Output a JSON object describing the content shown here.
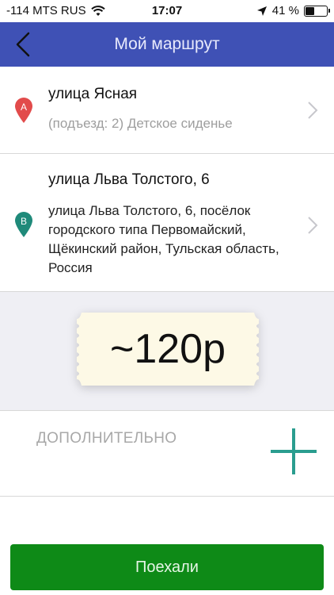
{
  "status_bar": {
    "carrier": "-114 MTS RUS",
    "time": "17:07",
    "battery_text": "41 %",
    "battery_level": 0.41
  },
  "nav": {
    "title": "Мой маршрут"
  },
  "route": {
    "point_a": {
      "marker": "A",
      "marker_color": "#e24b4b",
      "title": "улица Ясная",
      "subtitle": "(подъезд: 2) Детское сиденье"
    },
    "point_b": {
      "marker": "B",
      "marker_color": "#1f8a7a",
      "title": "улица Льва Толстого, 6",
      "address": "улица Льва Толстого, 6, посёлок городского типа Первомайский, Щёкинский район, Тульская область, Россия"
    }
  },
  "price": {
    "value": "~120р",
    "ticket_color": "#fdf9e6"
  },
  "extra": {
    "label": "ДОПОЛНИТЕЛЬНО",
    "plus_color": "#2a9d8f"
  },
  "go_button": {
    "label": "Поехали",
    "color": "#0e8a17"
  },
  "colors": {
    "nav": "#3f51b5",
    "price_bg": "#efeff4"
  }
}
